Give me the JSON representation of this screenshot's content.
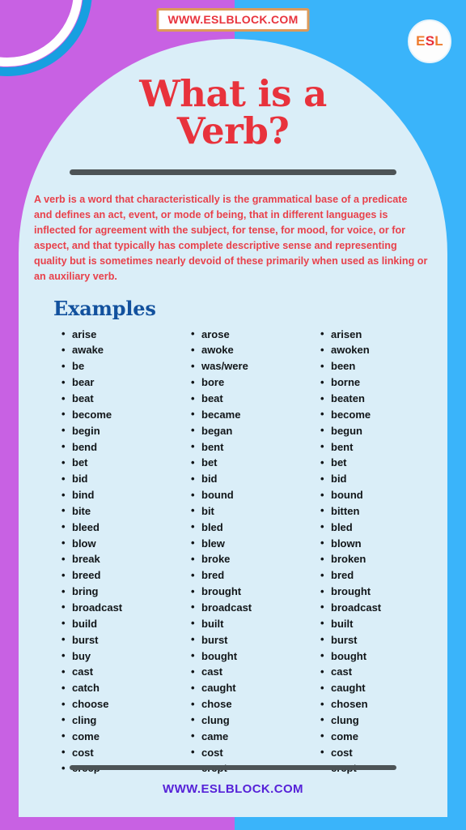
{
  "top_banner": {
    "url_text": "WWW.ESLBLOCK.COM"
  },
  "badge": {
    "letter_1": "E",
    "letter_2": "S",
    "letter_3": "L"
  },
  "title": {
    "line1": "What is a",
    "line2": "Verb?"
  },
  "description": {
    "text": "A verb is a word that characteristically is the grammatical base of a predicate and defines an act, event, or mode of being, that in different languages is inflected for agreement with the subject, for tense, for mood, for voice, or for aspect, and that typically has complete descriptive sense and representing quality but is sometimes nearly devoid of these primarily when used as linking or an auxiliary verb."
  },
  "examples": {
    "heading": "Examples",
    "columns": [
      {
        "name": "base-form",
        "items": [
          "arise",
          "awake",
          "be",
          "bear",
          "beat",
          "become",
          "begin",
          "bend",
          "bet",
          "bid",
          "bind",
          "bite",
          "bleed",
          "blow",
          "break",
          "breed",
          "bring",
          "broadcast",
          "build",
          "burst",
          "buy",
          "cast",
          "catch",
          "choose",
          "cling",
          "come",
          "cost",
          "creep"
        ]
      },
      {
        "name": "past-simple",
        "items": [
          "arose",
          "awoke",
          "was/were",
          "bore",
          "beat",
          "became",
          "began",
          "bent",
          "bet",
          "bid",
          "bound",
          "bit",
          "bled",
          "blew",
          "broke",
          "bred",
          "brought",
          "broadcast",
          "built",
          "burst",
          "bought",
          "cast",
          "caught",
          "chose",
          "clung",
          "came",
          "cost",
          "crept"
        ]
      },
      {
        "name": "past-participle",
        "items": [
          "arisen",
          "awoken",
          "been",
          "borne",
          "beaten",
          "become",
          "begun",
          "bent",
          "bet",
          "bid",
          "bound",
          "bitten",
          "bled",
          "blown",
          "broken",
          "bred",
          "brought",
          "broadcast",
          "built",
          "burst",
          "bought",
          "cast",
          "caught",
          "chosen",
          "clung",
          "come",
          "cost",
          "crept"
        ]
      }
    ]
  },
  "footer": {
    "url_text": "WWW.ESLBLOCK.COM"
  },
  "colors": {
    "background_left": "#c861e3",
    "background_right": "#3ab4fa",
    "card": "#daeef8",
    "title_red": "#e8323c",
    "description_red": "#e8414b",
    "heading_blue": "#12519e",
    "divider_gray": "#4c5356",
    "footer_purple": "#5622d8",
    "badge_orange": "#ee7b2e",
    "badge_red": "#e8303a",
    "banner_border": "#dd9a5a"
  }
}
